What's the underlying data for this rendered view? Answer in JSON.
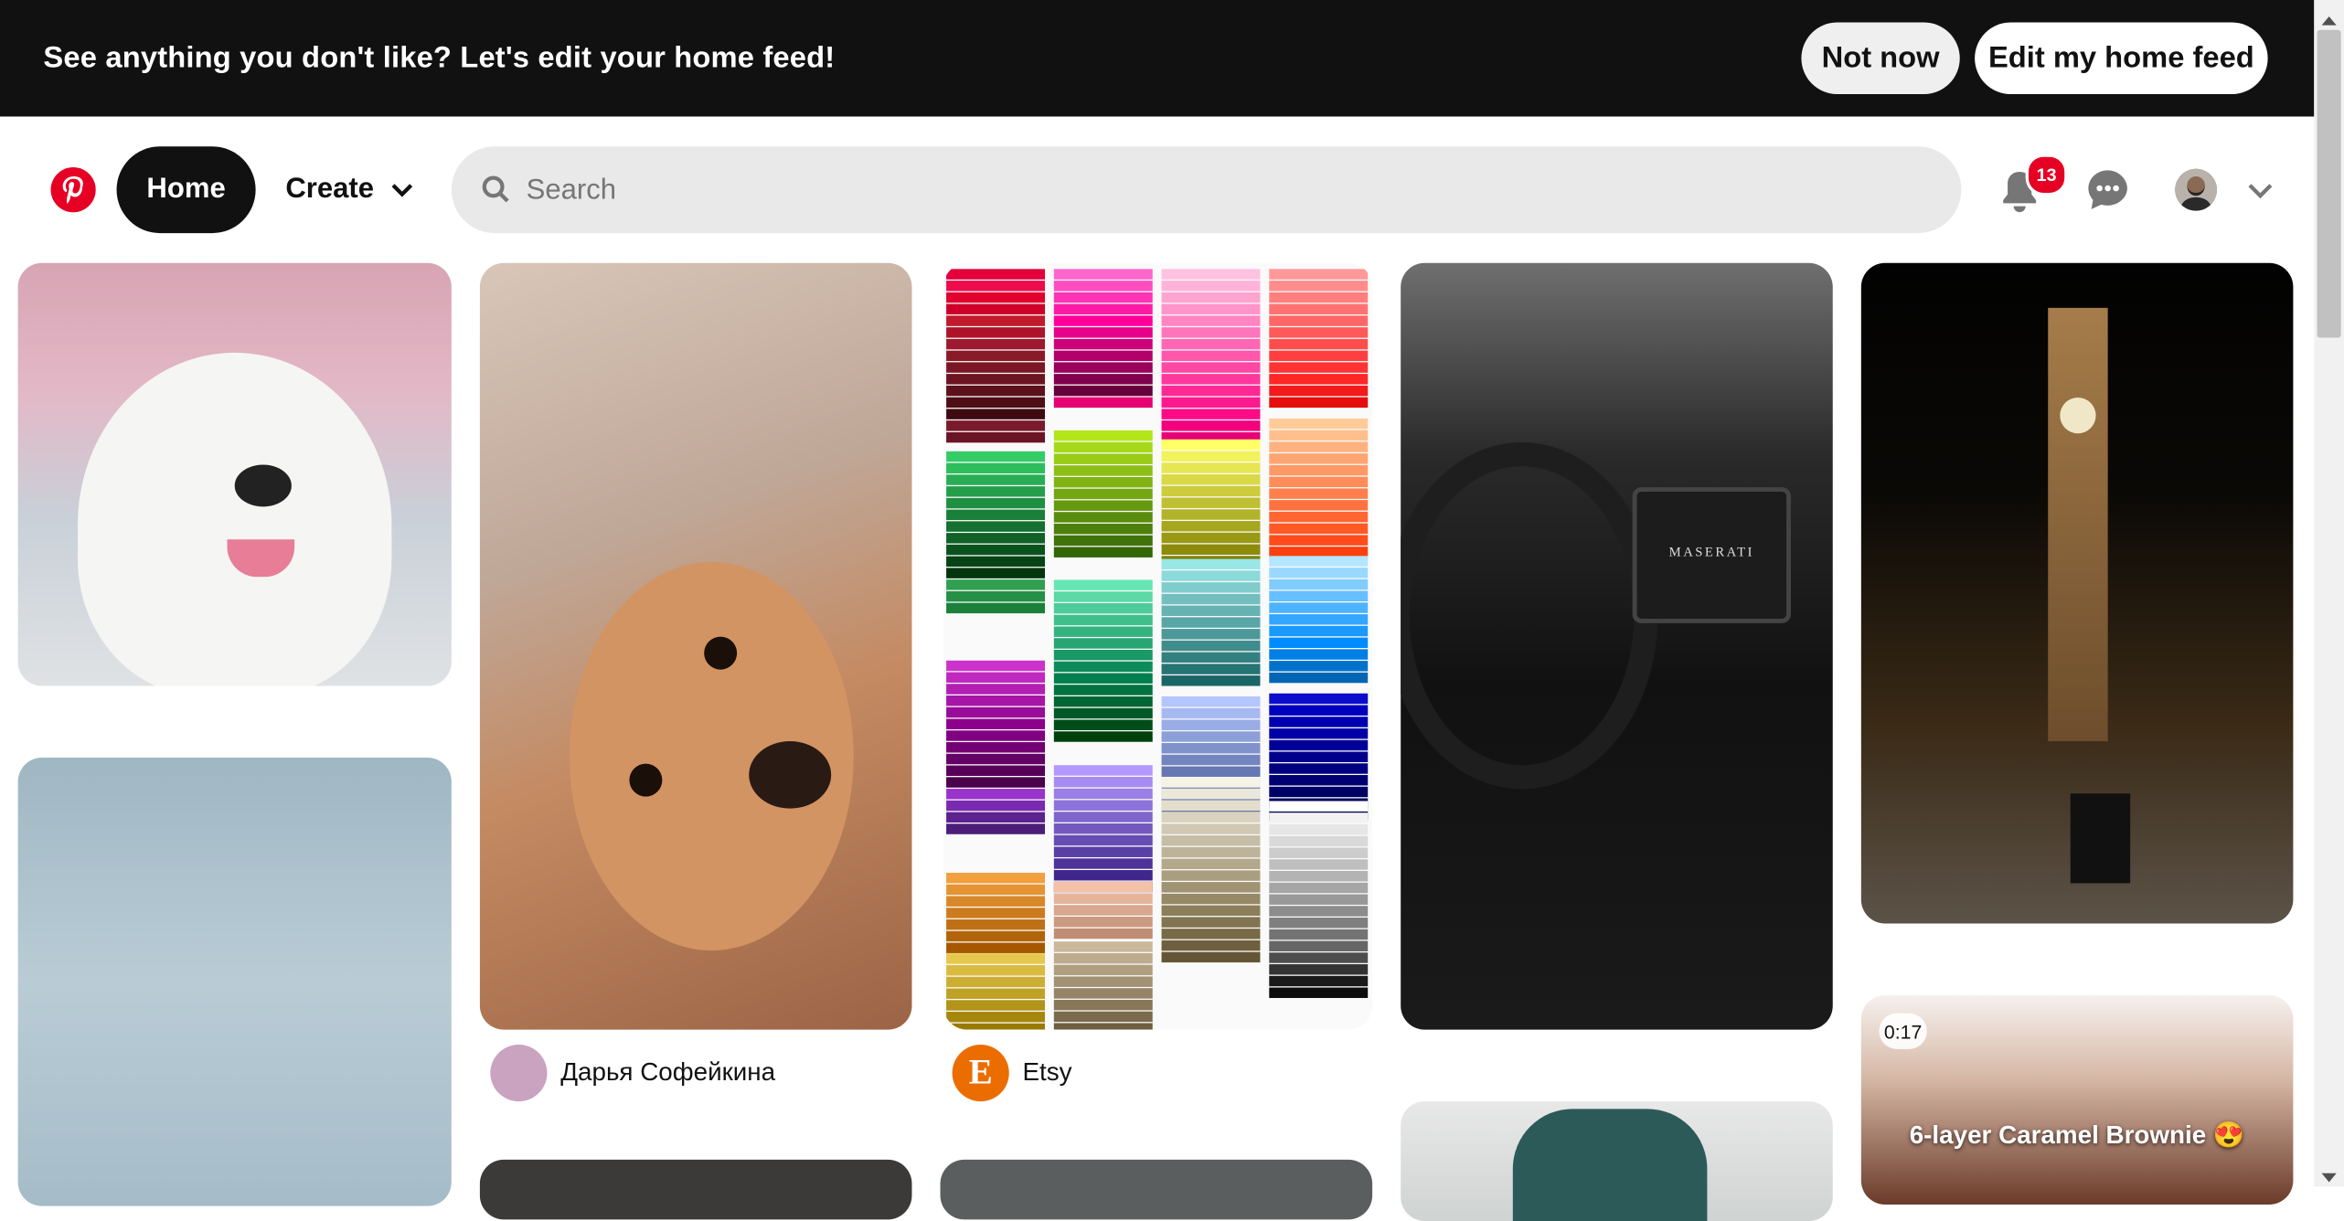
{
  "banner": {
    "message": "See anything you don't like? Let's edit your home feed!",
    "not_now_label": "Not now",
    "edit_label": "Edit my home feed"
  },
  "nav": {
    "home_label": "Home",
    "create_label": "Create",
    "search_placeholder": "Search",
    "notification_count": "13"
  },
  "pins": {
    "author1_name": "Дарья Софейкина",
    "author2_name": "Etsy",
    "author2_initial": "E",
    "video_duration": "0:17",
    "video_title": "6-layer Caramel Brownie 😍",
    "car_brand": "MASERATI"
  },
  "colors": {
    "brand": "#e60023",
    "banner_bg": "#111111"
  }
}
